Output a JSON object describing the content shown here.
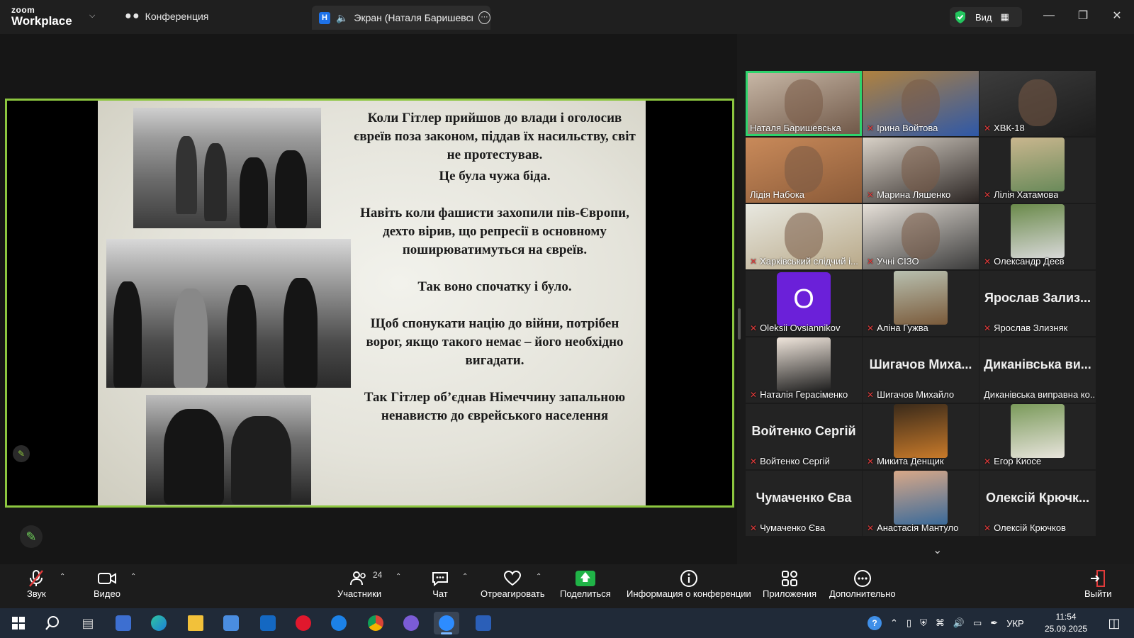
{
  "app": {
    "brand_top": "zoom",
    "brand_bottom": "Workplace"
  },
  "tabs": {
    "conference": "Конференция",
    "screen_badge": "Н",
    "screen": "Экран (Наталя Баришевськ"
  },
  "view": {
    "label": "Вид"
  },
  "slide": {
    "p1": "Коли Гітлер прийшов до влади і оголосив євреїв поза законом, піддав їх насильству, світ не протестував.",
    "p1b": "Це була чужа біда.",
    "p2": "Навіть коли фашисти захопили пів-Європи, дехто вірив, що репресії в основному поширюватимуться на євреїв.",
    "p3": "Так воно спочатку і було.",
    "p4": "Щоб спонукати націю до війни, потрібен ворог, якщо такого немає – його необхідно вигадати.",
    "p5": "Так Гітлер об’єднав Німеччину запальною ненавистю до єврейського населення"
  },
  "participants": [
    {
      "name": "Наталя Баришевська",
      "type": "video",
      "mic": "on",
      "colors": [
        "#c9b9a8",
        "#6e5646"
      ]
    },
    {
      "name": "Ірина Войтова",
      "type": "video",
      "mic": "off",
      "colors": [
        "#b0823f",
        "#2e58a8"
      ]
    },
    {
      "name": "ХВК-18",
      "type": "video",
      "mic": "off",
      "colors": [
        "#3c3c3c",
        "#1c1c1c"
      ]
    },
    {
      "name": "Лідія Набока",
      "type": "video",
      "mic": "none",
      "colors": [
        "#c98a5a",
        "#8a5a38"
      ]
    },
    {
      "name": "Марина Ляшенко",
      "type": "video",
      "mic": "off",
      "colors": [
        "#d9d2c8",
        "#2a2422"
      ]
    },
    {
      "name": "Лілія Хатамова",
      "type": "avatar",
      "mic": "off",
      "colors": [
        "#c9b68e",
        "#6a8a5a"
      ]
    },
    {
      "name": "Харківський слідчий і...",
      "type": "video",
      "mic": "off",
      "colors": [
        "#e8e8e0",
        "#b8a888"
      ]
    },
    {
      "name": "Учні СІЗО",
      "type": "video",
      "mic": "off",
      "colors": [
        "#e6e0d8",
        "#3a3a3a"
      ]
    },
    {
      "name": "Олександр Деєв",
      "type": "avatar",
      "mic": "off",
      "colors": [
        "#6a8a4a",
        "#d8d8d8"
      ]
    },
    {
      "name": "Oleksii Ovsiannikov",
      "type": "letter",
      "letter": "O",
      "mic": "off"
    },
    {
      "name": "Аліна Гужва",
      "type": "avatar",
      "mic": "off",
      "colors": [
        "#b8c0b0",
        "#7a5a3a"
      ]
    },
    {
      "name": "Ярослав Злизняк",
      "type": "text",
      "display": "Ярослав Зализ...",
      "mic": "off"
    },
    {
      "name": "Наталія Герасіменко",
      "type": "avatar",
      "mic": "off",
      "colors": [
        "#f0e6dc",
        "#1e1e1e"
      ]
    },
    {
      "name": "Шигачов Михайло",
      "type": "text",
      "display": "Шигачов Миха...",
      "mic": "off"
    },
    {
      "name": "Диканівська виправна ко...",
      "type": "text",
      "display": "Диканівська ви...",
      "mic": "none"
    },
    {
      "name": "Войтенко Сергій",
      "type": "text",
      "display": "Войтенко Сергій",
      "mic": "off"
    },
    {
      "name": "Микита Денщик",
      "type": "avatar",
      "mic": "off",
      "colors": [
        "#3a2a1a",
        "#c87a2a"
      ]
    },
    {
      "name": "Егор Киосе",
      "type": "avatar",
      "mic": "off",
      "colors": [
        "#7a9a5a",
        "#e8e4dc"
      ]
    },
    {
      "name": "Чумаченко Єва",
      "type": "text",
      "display": "Чумаченко Єва",
      "mic": "off"
    },
    {
      "name": "Анастасія Мантуло",
      "type": "avatar",
      "mic": "off",
      "colors": [
        "#d8a888",
        "#3a6a9a"
      ]
    },
    {
      "name": "Олексій Крючков",
      "type": "text",
      "display": "Олексій Крючк...",
      "mic": "off"
    }
  ],
  "toolbar": {
    "sound": "Звук",
    "video": "Видео",
    "participants": "Участники",
    "participants_count": "24",
    "chat": "Чат",
    "react": "Отреагировать",
    "share": "Поделиться",
    "info": "Информация о конференции",
    "apps": "Приложения",
    "more": "Дополнительно",
    "leave": "Выйти"
  },
  "taskbar": {
    "lang": "УКР",
    "time": "11:54",
    "date": "25.09.2025"
  },
  "colors": {
    "accent_green": "#8cc63f",
    "active_speaker": "#2ed36c",
    "mic_off": "#e23b3b",
    "share_green": "#20b347"
  }
}
